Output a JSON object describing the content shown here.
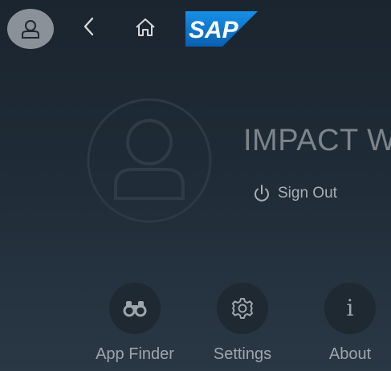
{
  "header": {
    "logo_text": "SAP",
    "icons": {
      "user": "person-icon",
      "back": "chevron-left-icon",
      "home": "home-icon"
    }
  },
  "profile": {
    "user_name": "IMPACT W",
    "avatar_icon": "person-icon",
    "sign_out_label": "Sign Out",
    "sign_out_icon": "power-icon"
  },
  "actions": [
    {
      "label": "App Finder",
      "icon": "binoculars-icon"
    },
    {
      "label": "Settings",
      "icon": "gear-icon"
    },
    {
      "label": "About",
      "icon": "info-icon"
    }
  ],
  "colors": {
    "background_top": "#1b2530",
    "background_bottom": "#2a3744",
    "sap_blue": "#0a6ed1"
  }
}
